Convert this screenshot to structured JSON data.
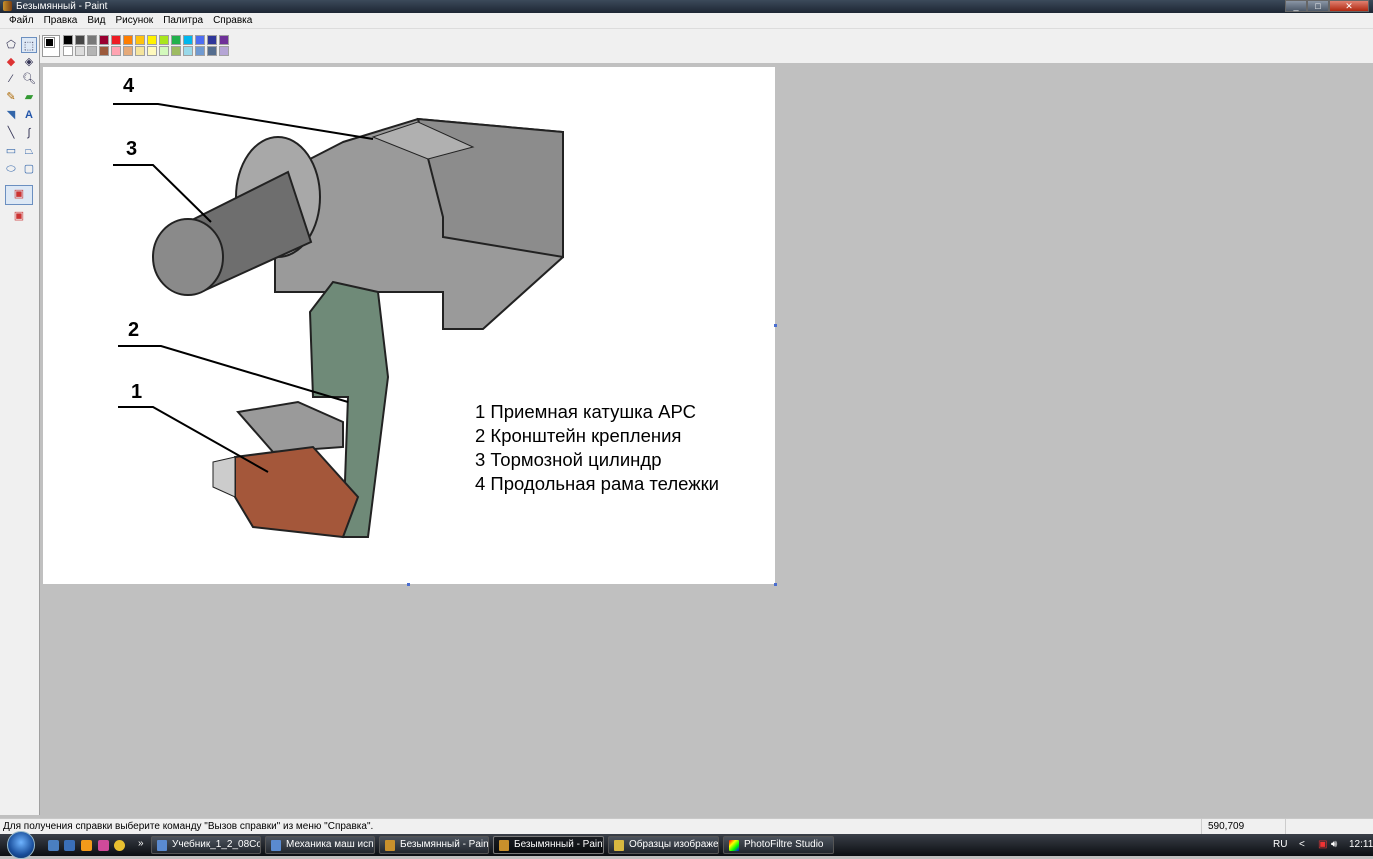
{
  "window": {
    "title": "Безымянный - Paint"
  },
  "menu": [
    "Файл",
    "Правка",
    "Вид",
    "Рисунок",
    "Палитра",
    "Справка"
  ],
  "palette": [
    "#000000",
    "#464646",
    "#787878",
    "#990030",
    "#ed1c24",
    "#ff7e00",
    "#ffc20e",
    "#fff200",
    "#a8e61d",
    "#22b14c",
    "#00b7ef",
    "#4d6df3",
    "#2f3699",
    "#6f3198",
    "#ffffff",
    "#dcdcdc",
    "#b4b4b4",
    "#9c5a3c",
    "#ffa3b1",
    "#e5aa7a",
    "#f5e49c",
    "#fff9bd",
    "#d3f9bc",
    "#9dbb61",
    "#99d9ea",
    "#709ad1",
    "#546d8e",
    "#b5a5d5"
  ],
  "drawing": {
    "callouts": [
      "1",
      "2",
      "3",
      "4"
    ],
    "legend": [
      "1 Приемная катушка АРС",
      "2 Кронштейн крепления",
      "3 Тормозной цилиндр",
      "4 Продольная рама тележки"
    ]
  },
  "status": {
    "help": "Для получения справки выберите команду \"Вызов справки\" из меню \"Справка\".",
    "coords": "590,709"
  },
  "taskbar": {
    "overflow": "»",
    "tasks": [
      "Учебник_1_2_08Со...",
      "Механика маш исп...",
      "Безымянный - Paint",
      "Безымянный - Paint",
      "Образцы изображе...",
      "PhotoFiltre Studio"
    ],
    "lang": "RU",
    "arrow": "<",
    "clock": "12:11"
  }
}
